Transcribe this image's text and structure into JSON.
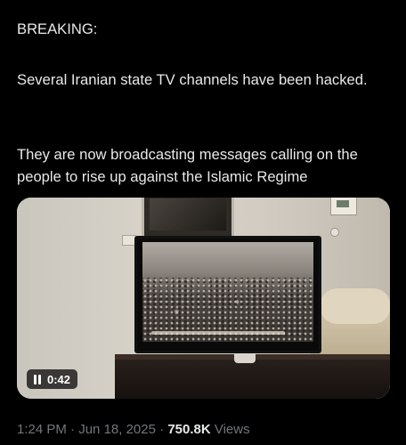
{
  "post": {
    "line_breaking": "BREAKING:",
    "paragraph_hack": "Several Iranian state TV channels have been hacked.",
    "paragraph_broadcast": "They are now broadcasting messages calling on the people to rise up against the Islamic Regime"
  },
  "video": {
    "state_icon": "pause-icon",
    "duration": "0:42"
  },
  "meta": {
    "time": "1:24 PM",
    "separator": "·",
    "date": "Jun 18, 2025",
    "views_count": "750.8K",
    "views_label": "Views"
  }
}
